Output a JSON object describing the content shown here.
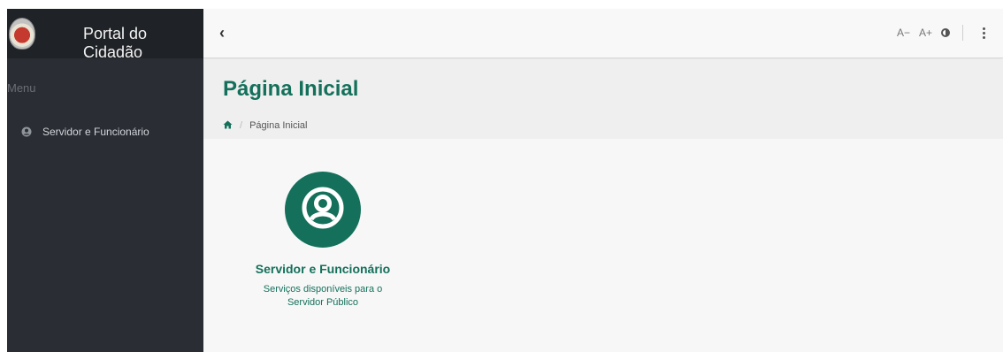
{
  "sidebar": {
    "brand_title": "Portal do Cidadão",
    "menu_heading": "Menu",
    "items": [
      {
        "label": "Servidor e Funcionário",
        "icon": "user-circle-icon"
      }
    ]
  },
  "topbar": {
    "font_decrease": "A−",
    "font_increase": "A+"
  },
  "page": {
    "title": "Página Inicial",
    "breadcrumb": {
      "current": "Página Inicial"
    }
  },
  "cards": [
    {
      "title": "Servidor e Funcionário",
      "description": "Serviços disponíveis para o Servidor Público",
      "icon": "user-circle-icon"
    }
  ],
  "colors": {
    "accent": "#14705b",
    "sidebar_bg": "#2a2d33",
    "brand_bg": "#1f2226"
  }
}
